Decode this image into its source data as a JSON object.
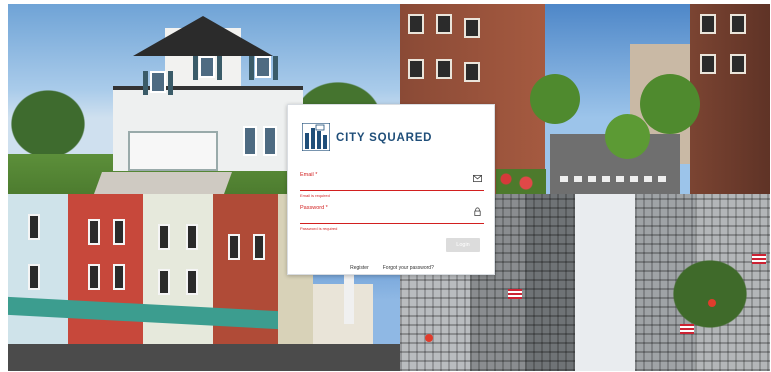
{
  "brand": {
    "name": "CITY SQUARED",
    "logo_icon": "city-squared-logo-icon",
    "color": "#1f4e79"
  },
  "login": {
    "email_label": "Email *",
    "email_error": "Email is required",
    "email_icon": "envelope-icon",
    "password_label": "Password *",
    "password_error": "Password is required",
    "password_icon": "lock-icon",
    "login_button": "Login",
    "register_link": "Register",
    "forgot_link": "Forgot your password?",
    "error_color": "#d21f1f"
  },
  "background_tiles": [
    "suburban-house-photo",
    "brick-street-photo",
    "row-houses-photo",
    "skyscraper-street-photo"
  ]
}
